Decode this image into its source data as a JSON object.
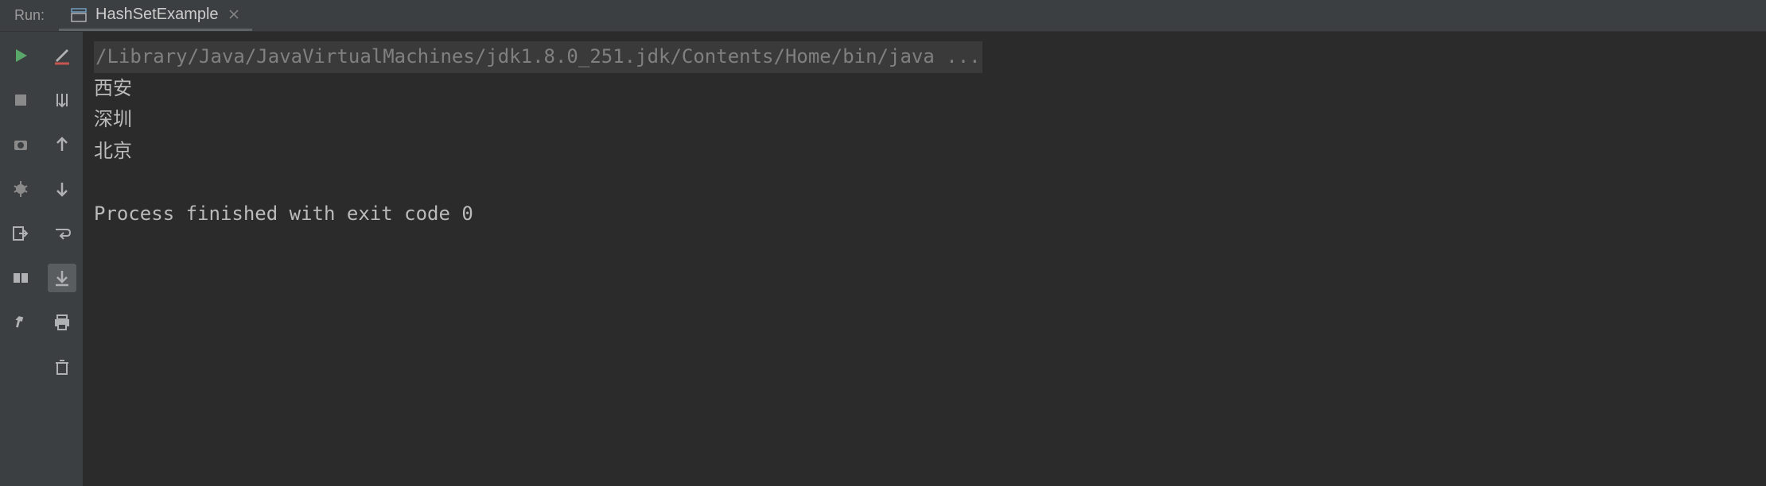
{
  "header": {
    "run_label": "Run:",
    "tab": {
      "label": "HashSetExample"
    }
  },
  "console": {
    "command": "/Library/Java/JavaVirtualMachines/jdk1.8.0_251.jdk/Contents/Home/bin/java ...",
    "output_lines": [
      "西安",
      "深圳",
      "北京"
    ],
    "exit_message": "Process finished with exit code 0"
  },
  "icons": {
    "left": [
      "run",
      "stop",
      "screenshot",
      "debug",
      "exit",
      "layout",
      "pin"
    ],
    "right": [
      "edit",
      "steps",
      "up",
      "down",
      "wrap",
      "scroll",
      "print",
      "delete"
    ]
  },
  "colors": {
    "run_green": "#59a869",
    "edit_red": "#c75450",
    "icon_gray": "#afb1b3"
  }
}
